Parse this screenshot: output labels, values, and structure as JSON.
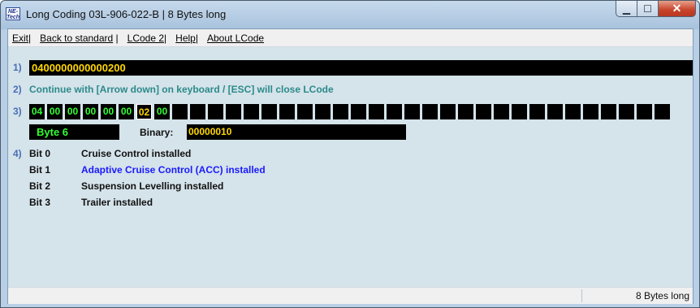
{
  "window": {
    "title": "Long Coding  03L-906-022-B | 8 Bytes long",
    "icon_text": "NE-Tech",
    "controls": {
      "minimize": "▁",
      "maximize": "☐",
      "close": "✕"
    }
  },
  "menu": {
    "items": [
      "Exit",
      "Back to standard",
      "LCode 2",
      "Help",
      "About LCode"
    ],
    "separator": "|"
  },
  "rows": {
    "n1": "1)",
    "n2": "2)",
    "n3": "3)",
    "n4": "4)"
  },
  "coding": {
    "value": "0400000000000200",
    "instruction": "Continue with [Arrow down] on keyboard / [ESC] will close LCode"
  },
  "bytes": {
    "values": [
      "04",
      "00",
      "00",
      "00",
      "00",
      "00",
      "02",
      "00"
    ],
    "selected_index": 6,
    "total_cells": 36
  },
  "byte_info": {
    "label": "Byte 6",
    "binary_label": "Binary:",
    "binary_value": "00000010"
  },
  "bits": [
    {
      "name": "Bit 0",
      "desc": "Cruise Control installed",
      "highlight": false
    },
    {
      "name": "Bit 1",
      "desc": "Adaptive Cruise Control (ACC) installed",
      "highlight": true
    },
    {
      "name": "Bit 2",
      "desc": "Suspension Levelling installed",
      "highlight": false
    },
    {
      "name": "Bit 3",
      "desc": "Trailer installed",
      "highlight": false
    }
  ],
  "status": {
    "text": "8 Bytes long"
  },
  "colors": {
    "code_text": "#ffd700",
    "byte_text": "#33ff33",
    "highlight_bit": "#1a1aff",
    "instruction": "#2b8a8a",
    "client_bg": "#d5e3ea"
  }
}
